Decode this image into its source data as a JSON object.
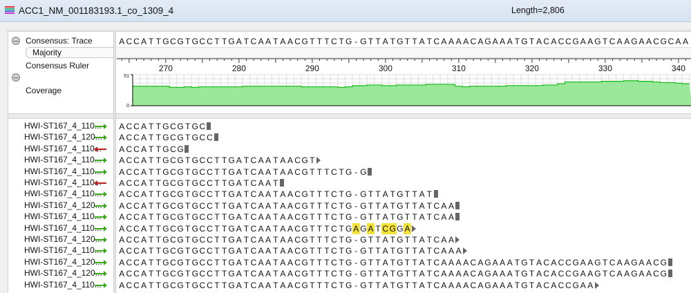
{
  "window": {
    "title": "ACC1_NM_001183193.1_co_1309_4",
    "length_label": "Length=2,806"
  },
  "labels": {
    "consensus_trace": "Consensus: Trace",
    "majority": "Majority",
    "consensus_ruler": "Consensus Ruler",
    "coverage": "Coverage"
  },
  "consensus": "ACCATTGCGTGCCTTGATCAATAACGTTTCTG-GTTATGTTATCAAAACAGAAATGTACACCGAAGTCAAGAACGCAA",
  "ruler": {
    "first_position": 264,
    "ticks": [
      "270",
      "280",
      "290",
      "300",
      "310",
      "320",
      "330",
      "340"
    ]
  },
  "chart_data": {
    "type": "area",
    "ylim": [
      0,
      51
    ],
    "ytick_labels": [
      "51",
      "0"
    ],
    "x_start": 265,
    "values": [
      31,
      32,
      32,
      32,
      32,
      32,
      30,
      30,
      31,
      30,
      31,
      31,
      31,
      31,
      31,
      31,
      32,
      32,
      32,
      32,
      32,
      32,
      32,
      32,
      31,
      31,
      31,
      31,
      31,
      30,
      31,
      33,
      33,
      34,
      34,
      33,
      33,
      34,
      34,
      34,
      34,
      35,
      35,
      35,
      35,
      32,
      31,
      32,
      32,
      32,
      32,
      32,
      33,
      33,
      33,
      33,
      33,
      34,
      34,
      36,
      39,
      39,
      39,
      39,
      39,
      40,
      40,
      40,
      41,
      41,
      40,
      40,
      39,
      38,
      38,
      37,
      36
    ]
  },
  "reads": [
    {
      "name": "HWI-ST167_4_110...",
      "dir": "fwd",
      "seq": "ACCATTGCGTGC",
      "end": "square",
      "mismatch": []
    },
    {
      "name": "HWI-ST167_4_120...",
      "dir": "fwd",
      "seq": "ACCATTGCGTGCC",
      "end": "square",
      "mismatch": []
    },
    {
      "name": "HWI-ST167_4_110...",
      "dir": "rev",
      "seq": "ACCATTGCG",
      "end": "square",
      "mismatch": []
    },
    {
      "name": "HWI-ST167_4_110...",
      "dir": "fwd",
      "seq": "ACCATTGCGTGCCTTGATCAATAACGT",
      "end": "arrow",
      "mismatch": []
    },
    {
      "name": "HWI-ST167_4_110...",
      "dir": "fwd",
      "seq": "ACCATTGCGTGCCTTGATCAATAACGTTTCTG-G",
      "end": "square",
      "mismatch": []
    },
    {
      "name": "HWI-ST167_4_110...",
      "dir": "rev",
      "seq": "ACCATTGCGTGCCTTGATCAAT",
      "end": "square",
      "mismatch": []
    },
    {
      "name": "HWI-ST167_4_110...",
      "dir": "fwd",
      "seq": "ACCATTGCGTGCCTTGATCAATAACGTTTCTG-GTTATGTTAT",
      "end": "square",
      "mismatch": []
    },
    {
      "name": "HWI-ST167_4_120...",
      "dir": "fwd",
      "seq": "ACCATTGCGTGCCTTGATCAATAACGTTTCTG-GTTATGTTATCAA",
      "end": "square",
      "mismatch": []
    },
    {
      "name": "HWI-ST167_4_110...",
      "dir": "fwd",
      "seq": "ACCATTGCGTGCCTTGATCAATAACGTTTCTG-GTTATGTTATCAA",
      "end": "square",
      "mismatch": []
    },
    {
      "name": "HWI-ST167_4_110...",
      "dir": "fwd",
      "seq": "ACCATTGCGTGCCTTGATCAATAACGTTTCTGAGATCGGA",
      "end": "arrow",
      "mismatch": [
        32,
        34,
        36,
        37,
        39
      ]
    },
    {
      "name": "HWI-ST167_4_120...",
      "dir": "fwd",
      "seq": "ACCATTGCGTGCCTTGATCAATAACGTTTCTG-GTTATGTTATCAA",
      "end": "arrow",
      "mismatch": []
    },
    {
      "name": "HWI-ST167_4_110...",
      "dir": "fwd",
      "seq": "ACCATTGCGTGCCTTGATCAATAACGTTTCTG-GTTATGTTATCAAA",
      "end": "arrow",
      "mismatch": []
    },
    {
      "name": "HWI-ST167_4_120...",
      "dir": "fwd",
      "seq": "ACCATTGCGTGCCTTGATCAATAACGTTTCTG-GTTATGTTATCAAAACAGAAATGTACACCGAAGTCAAGAACG",
      "end": "square",
      "mismatch": []
    },
    {
      "name": "HWI-ST167_4_120...",
      "dir": "fwd",
      "seq": "ACCATTGCGTGCCTTGATCAATAACGTTTCTG-GTTATGTTATCAAAACAGAAATGTACACCGAAGTCAAGAACG",
      "end": "square",
      "mismatch": []
    },
    {
      "name": "HWI-ST167_4_110...",
      "dir": "fwd",
      "seq": "ACCATTGCGTGCCTTGATCAATAACGTTTCTG-GTTATGTTATCAAAACAGAAATGTACACCGAA",
      "end": "arrow",
      "mismatch": []
    }
  ],
  "colors": {
    "coverage_fill": "#9be89b",
    "coverage_line": "#1fbf1f",
    "mismatch": "#f2e23a",
    "forward": "#3aaa1c",
    "reverse": "#b81c1c"
  }
}
